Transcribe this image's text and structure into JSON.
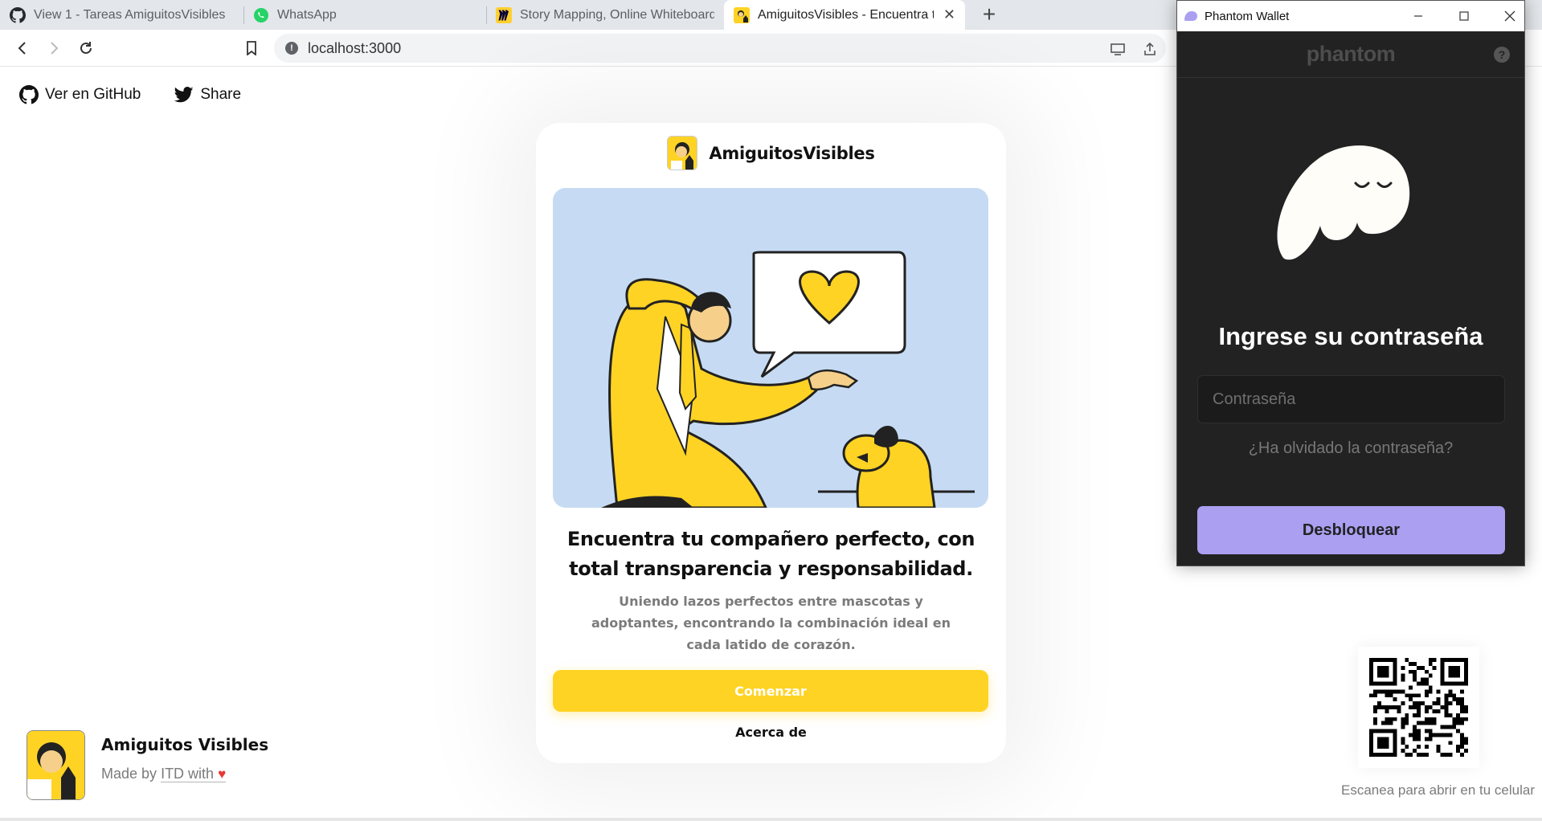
{
  "browser": {
    "tabs": [
      {
        "title": "View 1 - Tareas AmiguitosVisibles",
        "icon": "github-icon"
      },
      {
        "title": "WhatsApp",
        "icon": "whatsapp-icon"
      },
      {
        "title": "Story Mapping, Online Whiteboard for",
        "icon": "miro-icon"
      },
      {
        "title": "AmiguitosVisibles - Encuentra tu",
        "icon": "amiguitos-icon",
        "active": true
      }
    ],
    "url": "localhost:3000"
  },
  "page": {
    "nav": {
      "github_label": "Ver en GitHub",
      "share_label": "Share"
    },
    "card": {
      "brand_name": "AmiguitosVisibles",
      "headline": "Encuentra tu compañero perfecto, con total transparencia y responsabilidad.",
      "subtext": "Uniendo lazos perfectos entre mascotas y adoptantes, encontrando la combinación ideal en cada latido de corazón.",
      "cta_label": "Comenzar",
      "about_label": "Acerca de"
    },
    "footer": {
      "name": "Amiguitos Visibles",
      "made_by_prefix": "Made by",
      "made_by_link": "ITD with",
      "heart": "♥"
    },
    "qr": {
      "caption": "Escanea para abrir en tu celular"
    }
  },
  "wallet": {
    "window_title": "Phantom Wallet",
    "logo_text": "phantom",
    "help": "?",
    "title": "Ingrese su contraseña",
    "password_placeholder": "Contraseña",
    "forgot_label": "¿Ha olvidado la contraseña?",
    "unlock_label": "Desbloquear"
  },
  "colors": {
    "accent_yellow": "#ffd324",
    "wallet_bg": "#222222",
    "wallet_button": "#ab9ff2",
    "hero_bg": "#c6dbf3"
  }
}
